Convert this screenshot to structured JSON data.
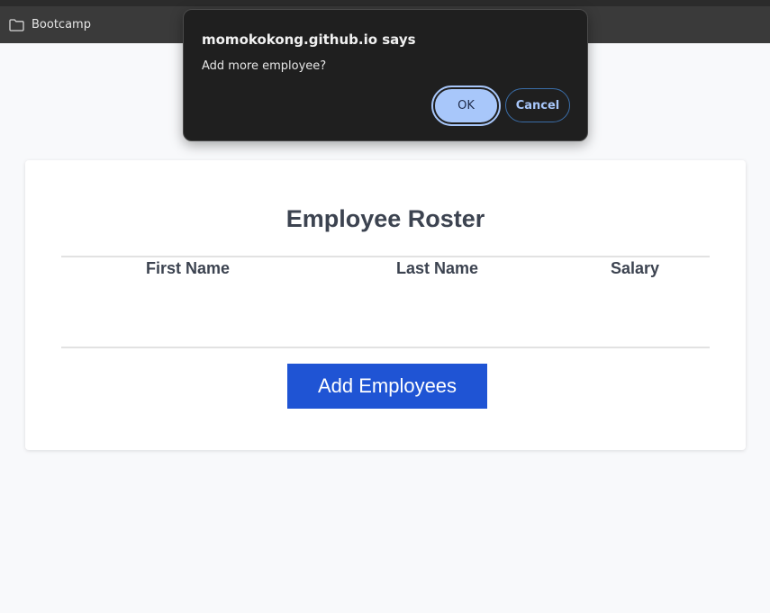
{
  "bookmarks_bar": {
    "items": [
      {
        "label": "Bootcamp",
        "icon": "folder-icon"
      }
    ]
  },
  "dialog": {
    "title": "momokokong.github.io says",
    "message": "Add more employee?",
    "ok_label": "OK",
    "cancel_label": "Cancel",
    "accent_color": "#a8c7fa"
  },
  "roster": {
    "title": "Employee Roster",
    "columns": [
      "First Name",
      "Last Name",
      "Salary"
    ],
    "rows": [],
    "add_button_label": "Add Employees",
    "button_color": "#1f54d4"
  }
}
